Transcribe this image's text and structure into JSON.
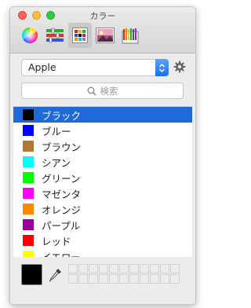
{
  "window": {
    "title": "カラー"
  },
  "toolbar": {
    "tools": [
      {
        "name": "color-wheel",
        "icon": "color-wheel-icon"
      },
      {
        "name": "color-sliders",
        "icon": "sliders-icon"
      },
      {
        "name": "color-palettes",
        "icon": "palette-grid-icon",
        "selected": true
      },
      {
        "name": "image-palettes",
        "icon": "image-palette-icon"
      },
      {
        "name": "pencils",
        "icon": "pencils-icon"
      }
    ]
  },
  "palette_select": {
    "value": "Apple"
  },
  "search": {
    "placeholder": "検索"
  },
  "colors": [
    {
      "label": "ブラック",
      "color": "#000000",
      "selected": true
    },
    {
      "label": "ブルー",
      "color": "#0000ff"
    },
    {
      "label": "ブラウン",
      "color": "#b07833"
    },
    {
      "label": "シアン",
      "color": "#00ffff"
    },
    {
      "label": "グリーン",
      "color": "#00ff00"
    },
    {
      "label": "マゼンタ",
      "color": "#ff00ff"
    },
    {
      "label": "オレンジ",
      "color": "#ff8800"
    },
    {
      "label": "パープル",
      "color": "#990099"
    },
    {
      "label": "レッド",
      "color": "#ff0000"
    },
    {
      "label": "イエロー",
      "color": "#ffff00"
    }
  ],
  "current_color": "#000000"
}
